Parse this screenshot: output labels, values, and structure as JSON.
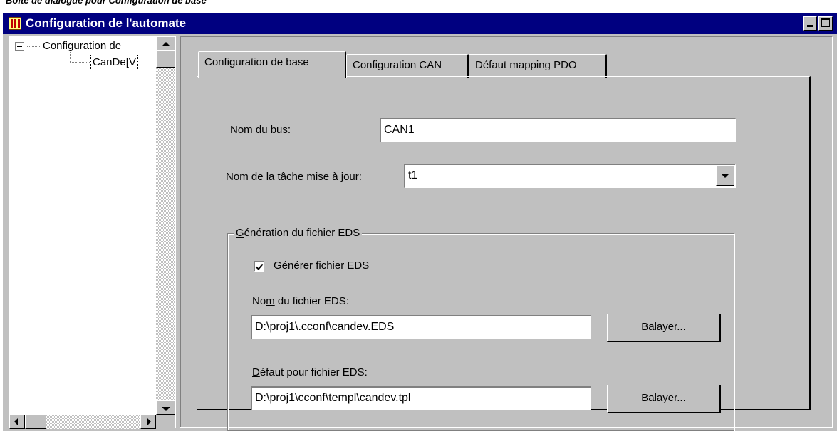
{
  "caption": "Boîte de dialogue pour Configuration de base",
  "window": {
    "title": "Configuration de l'automate",
    "minimize_label": "_",
    "maximize_label": "□"
  },
  "tree": {
    "root_label": "Configuration de",
    "child_label": "CanDe[V"
  },
  "tabs": [
    {
      "label": "Configuration de base",
      "active": true
    },
    {
      "label": "Configuration CAN",
      "active": false
    },
    {
      "label": "Défaut mapping PDO",
      "active": false
    }
  ],
  "form": {
    "bus_name": {
      "label_pre": "",
      "label_ul": "N",
      "label_post": "om du bus:",
      "value": "CAN1"
    },
    "task_name": {
      "label_pre": "N",
      "label_ul": "o",
      "label_post": "m de la tâche mise à jour:",
      "value": "t1"
    },
    "eds_group": {
      "legend_ul": "G",
      "legend_post": "énération du fichier EDS",
      "generate": {
        "label_pre": "G",
        "label_ul": "é",
        "label_post": "nérer fichier EDS",
        "checked": true
      },
      "eds_file": {
        "label_pre": "No",
        "label_ul": "m",
        "label_post": " du fichier EDS:",
        "value": "D:\\proj1\\.cconf\\candev.EDS",
        "browse_label": "Balayer..."
      },
      "eds_default": {
        "label_pre": "",
        "label_ul": "D",
        "label_post": "éfaut pour fichier EDS:",
        "value": "D:\\proj1\\cconf\\templ\\candev.tpl",
        "browse_label": "Balayer..."
      }
    }
  },
  "colors": {
    "titlebar": "#000080",
    "face": "#c0c0c0"
  }
}
